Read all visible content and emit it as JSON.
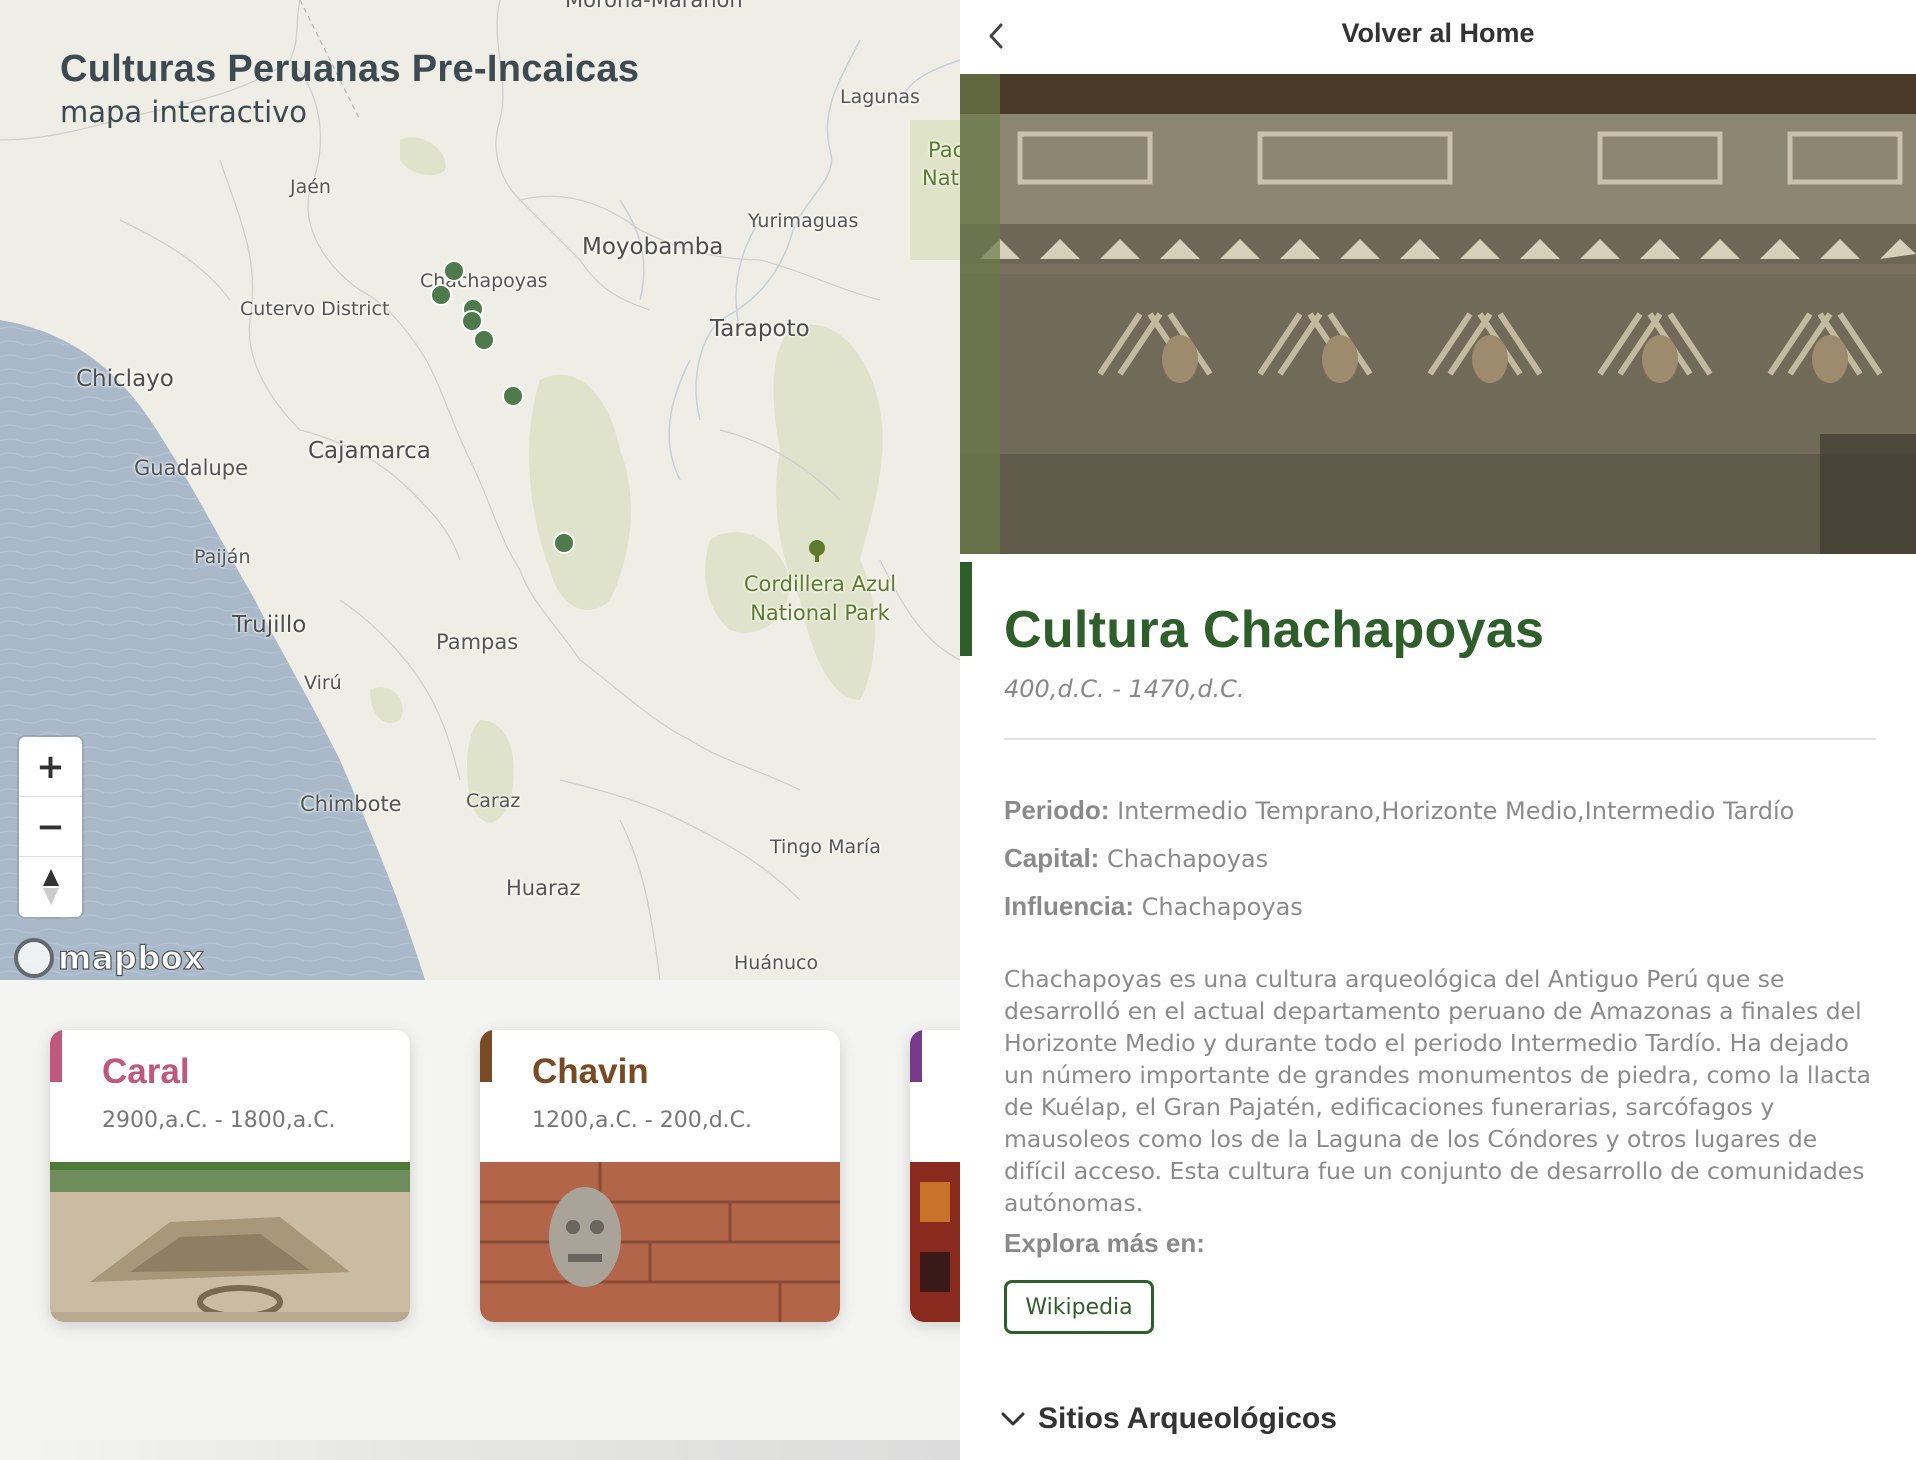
{
  "map": {
    "title": "Culturas Peruanas Pre-Incaicas",
    "subtitle": "mapa interactivo",
    "labels": {
      "maranon": "Morona-Marañon",
      "lagunas": "Lagunas",
      "pacaya": "Pac",
      "nat": "Nat",
      "jaen": "Jaén",
      "yurimaguas": "Yurimaguas",
      "moyobamba": "Moyobamba",
      "chachapoyas": "Chachapoyas",
      "cutervo": "Cutervo District",
      "tarapoto": "Tarapoto",
      "chiclayo": "Chiclayo",
      "cajamarca": "Cajamarca",
      "guadalupe": "Guadalupe",
      "paijan": "Paiján",
      "park_line1": "Cordillera Azul",
      "park_line2": "National Park",
      "trujillo": "Trujillo",
      "pampas": "Pampas",
      "viru": "Virú",
      "chimbote": "Chimbote",
      "caraz": "Caraz",
      "tingo_maria": "Tingo María",
      "huaraz": "Huaraz",
      "huanuco": "Huánuco"
    },
    "zoom_in": "+",
    "zoom_out": "−",
    "attribution": "mapbox",
    "marker_color": "#4f7a4b",
    "water_color": "#a9b9c9",
    "land_color": "#efeee6"
  },
  "cards": [
    {
      "title": "Caral",
      "dates": "2900,a.C. - 1800,a.C.",
      "color": "#c0587e"
    },
    {
      "title": "Chavin",
      "dates": "1200,a.C. - 200,d.C.",
      "color": "#7a4a22"
    },
    {
      "title": "",
      "dates": "",
      "color": "#7a3a8a"
    }
  ],
  "panel": {
    "home_label": "Volver al Home",
    "title": "Cultura Chachapoyas",
    "dates": "400,d.C. - 1470,d.C.",
    "periodo_label": "Periodo:",
    "periodo": "Intermedio Temprano,Horizonte Medio,Intermedio Tardío",
    "capital_label": "Capital:",
    "capital": "Chachapoyas",
    "influencia_label": "Influencia:",
    "influencia": "Chachapoyas",
    "description": "Chachapoyas es una cultura arqueológica del Antiguo Perú que se desarrolló en el actual departamento peruano de Amazonas a finales del Horizonte Medio y durante todo el periodo Intermedio Tardío. Ha dejado un número importante de grandes monumentos de piedra, como la llacta de Kuélap, el Gran Pajatén, edificaciones funerarias, sarcófagos y mausoleos como los de la Laguna de los Cóndores y otros lugares de difícil acceso. Esta cultura fue un conjunto de desarrollo de comunidades autónomas.",
    "explore_label": "Explora más en:",
    "wikipedia": "Wikipedia",
    "sites_label": "Sitios Arqueológicos",
    "accent_color": "#2e5e2a"
  }
}
